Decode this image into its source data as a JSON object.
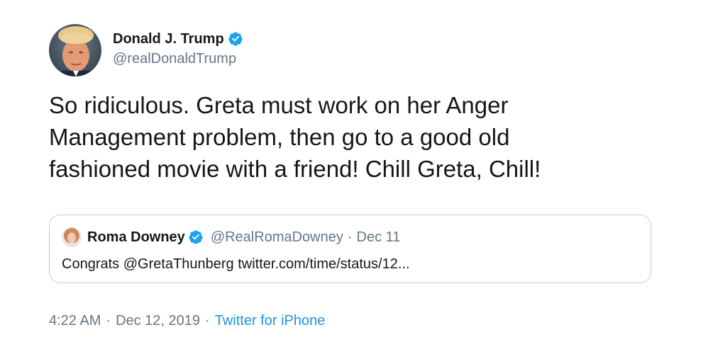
{
  "tweet": {
    "author": {
      "display_name": "Donald J. Trump",
      "handle": "@realDonaldTrump",
      "verified_icon": "verified-badge-icon",
      "avatar_icon": "avatar"
    },
    "text": "So ridiculous. Greta must work on her Anger Management problem, then go to a good old fashioned movie with a friend! Chill Greta, Chill!",
    "quoted": {
      "display_name": "Roma Downey",
      "handle": "@RealRomaDowney",
      "separator": "·",
      "date": "Dec 11",
      "text": "Congrats @GretaThunberg twitter.com/time/status/12..."
    },
    "meta": {
      "time": "4:22 AM",
      "separator1": "·",
      "date": "Dec 12, 2019",
      "separator2": "·",
      "source": "Twitter for iPhone"
    }
  },
  "colors": {
    "verified": "#1da1f2",
    "secondary_text": "#657786",
    "link": "#1b95e0",
    "border": "#c4cfd6",
    "primary_text": "#14171a"
  }
}
